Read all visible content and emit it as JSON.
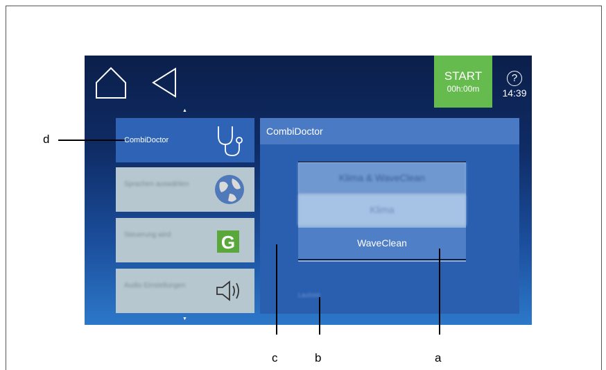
{
  "nav": {
    "home_icon": "home-icon",
    "back_icon": "back-triangle-icon"
  },
  "start_button": {
    "label": "START",
    "time": "00h:00m"
  },
  "help": {
    "symbol": "?",
    "clock": "14:39"
  },
  "menu": {
    "scroll_up": "▲",
    "scroll_down": "▼",
    "items": [
      {
        "label": "CombiDoctor",
        "icon": "stethoscope-icon",
        "active": true
      },
      {
        "label": "Sprachen auswählen",
        "icon": "globe-icon",
        "active": false
      },
      {
        "label": "Steuerung wird",
        "icon": "g-logo-icon",
        "active": false
      },
      {
        "label": "Audio Einstellungen",
        "icon": "speaker-icon",
        "active": false
      }
    ]
  },
  "panel": {
    "title": "CombiDoctor",
    "picker_options": [
      "Klima & WaveClean",
      "Klima",
      "WaveClean"
    ],
    "selected": "WaveClean",
    "footer": "Laufzeit"
  },
  "callouts": {
    "a": "a",
    "b": "b",
    "c": "c",
    "d": "d"
  },
  "colors": {
    "start_green": "#66bb4f",
    "panel_blue": "#2a5fb0",
    "header_blue": "#4a7ac4"
  }
}
